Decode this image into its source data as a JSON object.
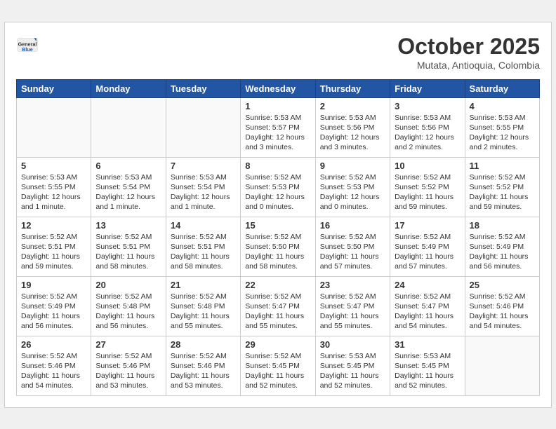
{
  "header": {
    "logo_general": "General",
    "logo_blue": "Blue",
    "month_title": "October 2025",
    "subtitle": "Mutata, Antioquia, Colombia"
  },
  "weekdays": [
    "Sunday",
    "Monday",
    "Tuesday",
    "Wednesday",
    "Thursday",
    "Friday",
    "Saturday"
  ],
  "weeks": [
    [
      {
        "day": "",
        "info": ""
      },
      {
        "day": "",
        "info": ""
      },
      {
        "day": "",
        "info": ""
      },
      {
        "day": "1",
        "info": "Sunrise: 5:53 AM\nSunset: 5:57 PM\nDaylight: 12 hours\nand 3 minutes."
      },
      {
        "day": "2",
        "info": "Sunrise: 5:53 AM\nSunset: 5:56 PM\nDaylight: 12 hours\nand 3 minutes."
      },
      {
        "day": "3",
        "info": "Sunrise: 5:53 AM\nSunset: 5:56 PM\nDaylight: 12 hours\nand 2 minutes."
      },
      {
        "day": "4",
        "info": "Sunrise: 5:53 AM\nSunset: 5:55 PM\nDaylight: 12 hours\nand 2 minutes."
      }
    ],
    [
      {
        "day": "5",
        "info": "Sunrise: 5:53 AM\nSunset: 5:55 PM\nDaylight: 12 hours\nand 1 minute."
      },
      {
        "day": "6",
        "info": "Sunrise: 5:53 AM\nSunset: 5:54 PM\nDaylight: 12 hours\nand 1 minute."
      },
      {
        "day": "7",
        "info": "Sunrise: 5:53 AM\nSunset: 5:54 PM\nDaylight: 12 hours\nand 1 minute."
      },
      {
        "day": "8",
        "info": "Sunrise: 5:52 AM\nSunset: 5:53 PM\nDaylight: 12 hours\nand 0 minutes."
      },
      {
        "day": "9",
        "info": "Sunrise: 5:52 AM\nSunset: 5:53 PM\nDaylight: 12 hours\nand 0 minutes."
      },
      {
        "day": "10",
        "info": "Sunrise: 5:52 AM\nSunset: 5:52 PM\nDaylight: 11 hours\nand 59 minutes."
      },
      {
        "day": "11",
        "info": "Sunrise: 5:52 AM\nSunset: 5:52 PM\nDaylight: 11 hours\nand 59 minutes."
      }
    ],
    [
      {
        "day": "12",
        "info": "Sunrise: 5:52 AM\nSunset: 5:51 PM\nDaylight: 11 hours\nand 59 minutes."
      },
      {
        "day": "13",
        "info": "Sunrise: 5:52 AM\nSunset: 5:51 PM\nDaylight: 11 hours\nand 58 minutes."
      },
      {
        "day": "14",
        "info": "Sunrise: 5:52 AM\nSunset: 5:51 PM\nDaylight: 11 hours\nand 58 minutes."
      },
      {
        "day": "15",
        "info": "Sunrise: 5:52 AM\nSunset: 5:50 PM\nDaylight: 11 hours\nand 58 minutes."
      },
      {
        "day": "16",
        "info": "Sunrise: 5:52 AM\nSunset: 5:50 PM\nDaylight: 11 hours\nand 57 minutes."
      },
      {
        "day": "17",
        "info": "Sunrise: 5:52 AM\nSunset: 5:49 PM\nDaylight: 11 hours\nand 57 minutes."
      },
      {
        "day": "18",
        "info": "Sunrise: 5:52 AM\nSunset: 5:49 PM\nDaylight: 11 hours\nand 56 minutes."
      }
    ],
    [
      {
        "day": "19",
        "info": "Sunrise: 5:52 AM\nSunset: 5:49 PM\nDaylight: 11 hours\nand 56 minutes."
      },
      {
        "day": "20",
        "info": "Sunrise: 5:52 AM\nSunset: 5:48 PM\nDaylight: 11 hours\nand 56 minutes."
      },
      {
        "day": "21",
        "info": "Sunrise: 5:52 AM\nSunset: 5:48 PM\nDaylight: 11 hours\nand 55 minutes."
      },
      {
        "day": "22",
        "info": "Sunrise: 5:52 AM\nSunset: 5:47 PM\nDaylight: 11 hours\nand 55 minutes."
      },
      {
        "day": "23",
        "info": "Sunrise: 5:52 AM\nSunset: 5:47 PM\nDaylight: 11 hours\nand 55 minutes."
      },
      {
        "day": "24",
        "info": "Sunrise: 5:52 AM\nSunset: 5:47 PM\nDaylight: 11 hours\nand 54 minutes."
      },
      {
        "day": "25",
        "info": "Sunrise: 5:52 AM\nSunset: 5:46 PM\nDaylight: 11 hours\nand 54 minutes."
      }
    ],
    [
      {
        "day": "26",
        "info": "Sunrise: 5:52 AM\nSunset: 5:46 PM\nDaylight: 11 hours\nand 54 minutes."
      },
      {
        "day": "27",
        "info": "Sunrise: 5:52 AM\nSunset: 5:46 PM\nDaylight: 11 hours\nand 53 minutes."
      },
      {
        "day": "28",
        "info": "Sunrise: 5:52 AM\nSunset: 5:46 PM\nDaylight: 11 hours\nand 53 minutes."
      },
      {
        "day": "29",
        "info": "Sunrise: 5:52 AM\nSunset: 5:45 PM\nDaylight: 11 hours\nand 52 minutes."
      },
      {
        "day": "30",
        "info": "Sunrise: 5:53 AM\nSunset: 5:45 PM\nDaylight: 11 hours\nand 52 minutes."
      },
      {
        "day": "31",
        "info": "Sunrise: 5:53 AM\nSunset: 5:45 PM\nDaylight: 11 hours\nand 52 minutes."
      },
      {
        "day": "",
        "info": ""
      }
    ]
  ]
}
